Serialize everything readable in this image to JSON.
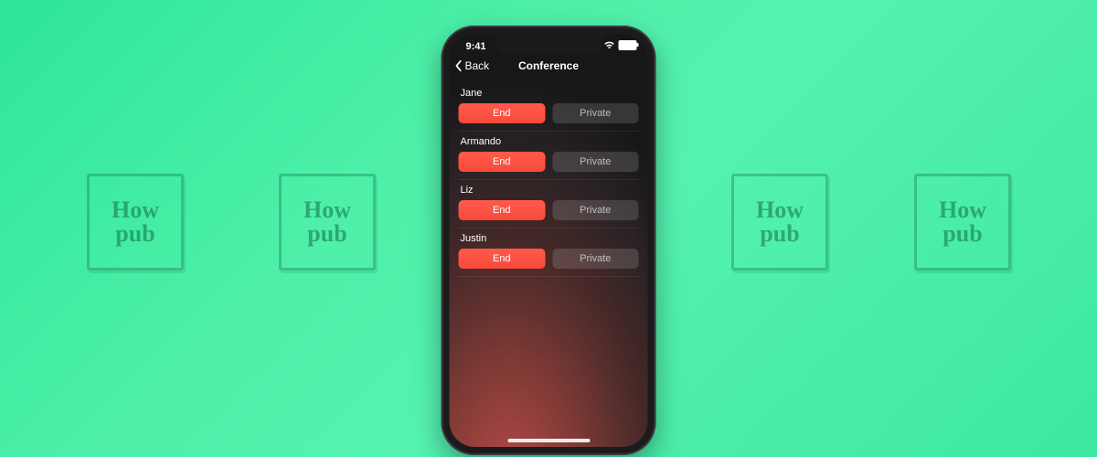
{
  "watermark": {
    "line1": "How",
    "line2": "pub"
  },
  "status": {
    "time": "9:41"
  },
  "nav": {
    "back": "Back",
    "title": "Conference"
  },
  "labels": {
    "end": "End",
    "private": "Private"
  },
  "participants": [
    {
      "name": "Jane"
    },
    {
      "name": "Armando"
    },
    {
      "name": "Liz"
    },
    {
      "name": "Justin"
    }
  ]
}
